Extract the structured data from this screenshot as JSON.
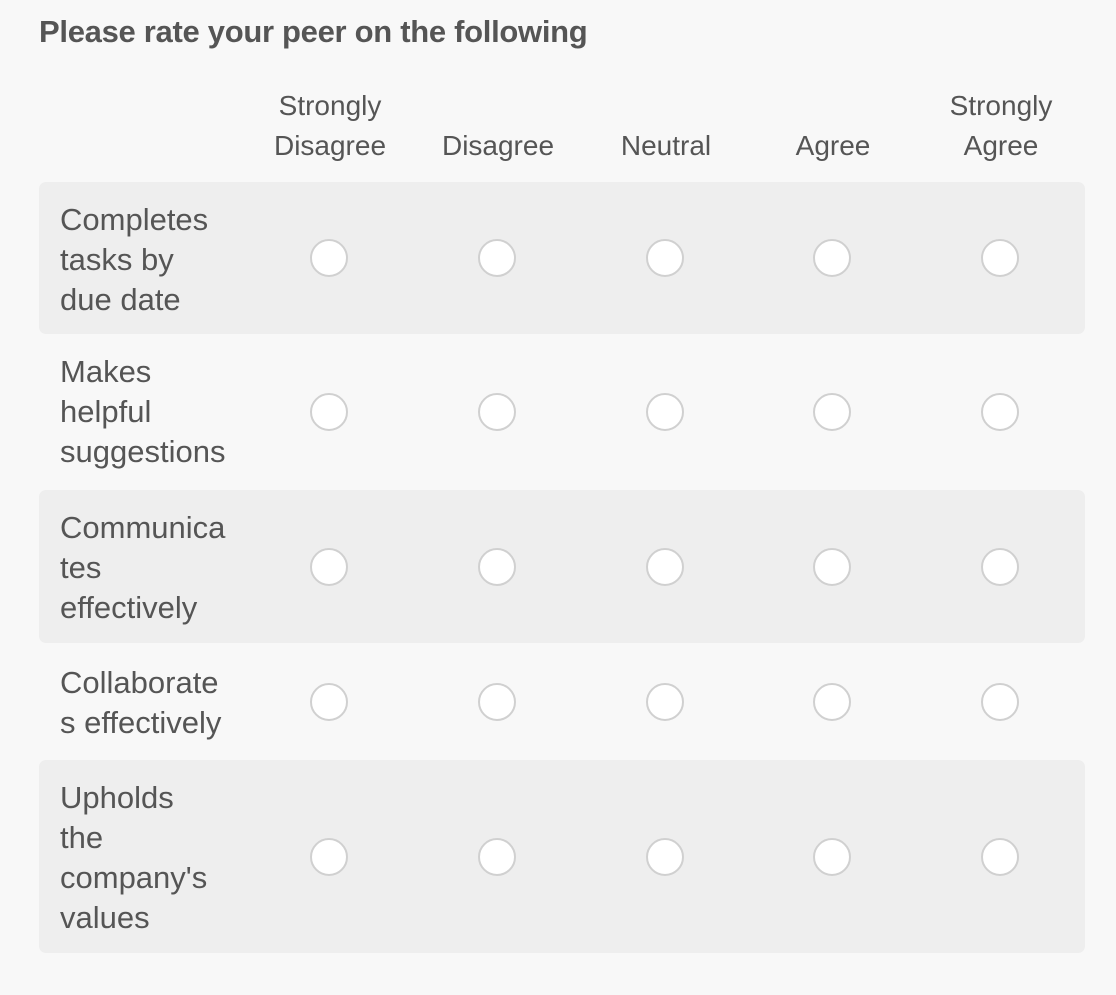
{
  "title": "Please rate your peer on the following",
  "columns": [
    {
      "label": "Strongly\nDisagree",
      "line1": "Strongly",
      "line2": "Disagree"
    },
    {
      "label": "Disagree",
      "line1": "",
      "line2": "Disagree"
    },
    {
      "label": "Neutral",
      "line1": "",
      "line2": "Neutral"
    },
    {
      "label": "Agree",
      "line1": "",
      "line2": "Agree"
    },
    {
      "label": "Strongly\nAgree",
      "line1": "Strongly",
      "line2": "Agree"
    }
  ],
  "rows": [
    {
      "label": "Completes tasks by due date",
      "selected": null
    },
    {
      "label": "Makes helpful suggestions",
      "selected": null
    },
    {
      "label": "Communicates effectively",
      "selected": null
    },
    {
      "label": "Collaborates effectively",
      "selected": null
    },
    {
      "label": "Upholds the company's values",
      "selected": null
    }
  ],
  "colors": {
    "background": "#f8f8f8",
    "row_shade": "#eeeeee",
    "text": "#555555",
    "radio_border": "#d0d0d0"
  }
}
